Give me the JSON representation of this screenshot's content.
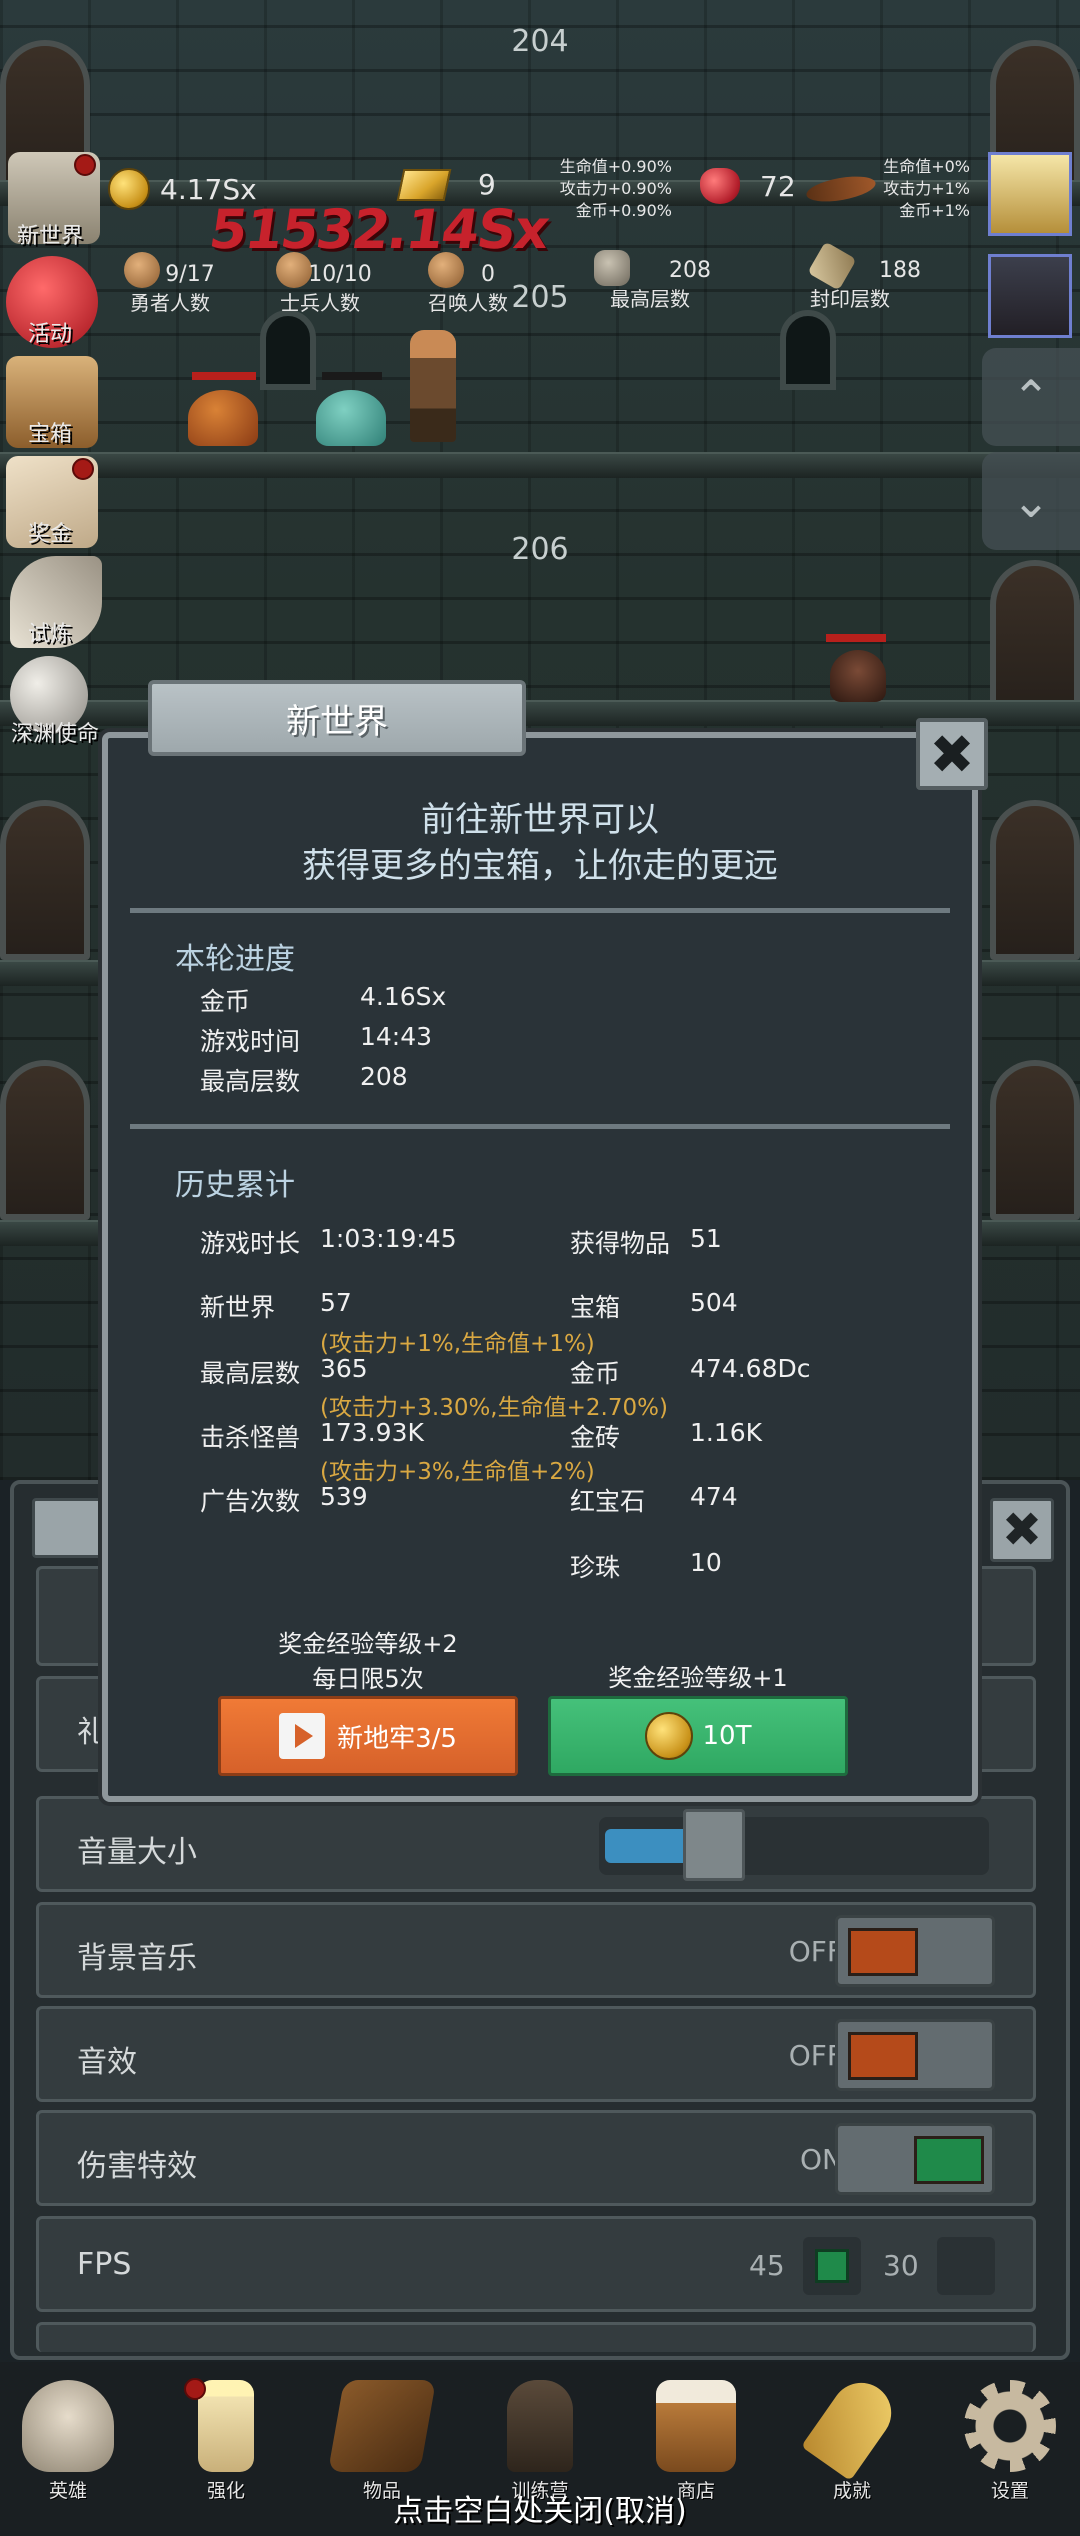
{
  "floors": [
    "204",
    "205",
    "206"
  ],
  "hud": {
    "gold": "4.17Sx",
    "gold_bars": "9",
    "buffs_left": [
      "生命值+0.90%",
      "攻击力+0.90%",
      "金币+0.90%"
    ],
    "rubies": "72",
    "buffs_right": [
      "生命值+0%",
      "攻击力+1%",
      "金币+1%"
    ],
    "damage_popup": "51532.14Sx",
    "heroes": {
      "value": "9/17",
      "label": "勇者人数"
    },
    "soldiers": {
      "value": "10/10",
      "label": "士兵人数"
    },
    "summons": {
      "value": "0",
      "label": "召唤人数"
    },
    "max_floor": {
      "value": "208",
      "label": "最高层数"
    },
    "sealed_floor": {
      "value": "188",
      "label": "封印层数"
    }
  },
  "side_menu": [
    "新世界",
    "活动",
    "宝箱",
    "奖金",
    "试炼",
    "深渊使命"
  ],
  "right_controls": {
    "up": "⌃",
    "down": "⌄"
  },
  "settings": {
    "close": "✖",
    "rows": [
      {
        "label": "礼",
        "state": ""
      },
      {
        "label": "音量大小",
        "state": "",
        "volume": 0.22
      },
      {
        "label": "背景音乐",
        "state": "OFF"
      },
      {
        "label": "音效",
        "state": "OFF"
      },
      {
        "label": "伤害特效",
        "state": "ON"
      },
      {
        "label": "FPS",
        "fps_a": "45",
        "fps_b": "30"
      }
    ]
  },
  "modal": {
    "title": "新世界",
    "close": "✖",
    "intro_line1": "前往新世界可以",
    "intro_line2": "获得更多的宝箱，让你走的更远",
    "round": {
      "title": "本轮进度",
      "rows": [
        {
          "label": "金币",
          "value": "4.16Sx"
        },
        {
          "label": "游戏时间",
          "value": "14:43"
        },
        {
          "label": "最高层数",
          "value": "208"
        }
      ]
    },
    "history": {
      "title": "历史累计",
      "left": [
        {
          "label": "游戏时长",
          "value": "1:03:19:45",
          "bonus": ""
        },
        {
          "label": "新世界",
          "value": "57",
          "bonus": "(攻击力+1%,生命值+1%)"
        },
        {
          "label": "最高层数",
          "value": "365",
          "bonus": "(攻击力+3.30%,生命值+2.70%)"
        },
        {
          "label": "击杀怪兽",
          "value": "173.93K",
          "bonus": "(攻击力+3%,生命值+2%)"
        },
        {
          "label": "广告次数",
          "value": "539",
          "bonus": ""
        }
      ],
      "right": [
        {
          "label": "获得物品",
          "value": "51"
        },
        {
          "label": "宝箱",
          "value": "504"
        },
        {
          "label": "金币",
          "value": "474.68Dc"
        },
        {
          "label": "金砖",
          "value": "1.16K"
        },
        {
          "label": "红宝石",
          "value": "474"
        },
        {
          "label": "珍珠",
          "value": "10"
        }
      ]
    },
    "reward_left_line1": "奖金经验等级+2",
    "reward_left_line2": "每日限5次",
    "reward_right": "奖金经验等级+1",
    "btn_video_label": "新地牢3/5",
    "btn_gold_label": "10T"
  },
  "bottom_nav": [
    "英雄",
    "强化",
    "物品",
    "训练营",
    "商店",
    "成就",
    "设置"
  ],
  "hint": "点击空白处关闭(取消)"
}
